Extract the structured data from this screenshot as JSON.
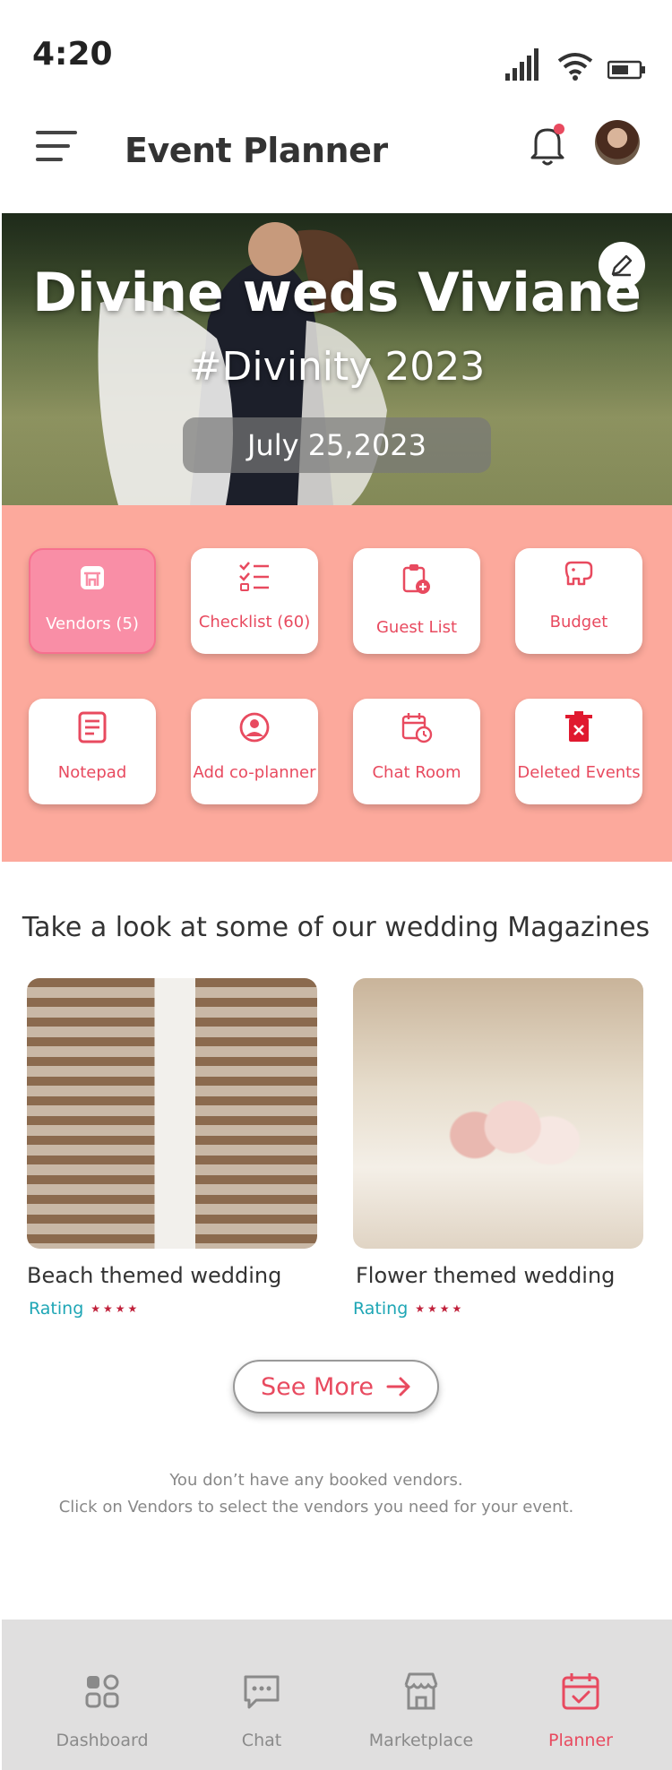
{
  "status_bar": {
    "time": "4:20"
  },
  "app_bar": {
    "title": "Event Planner"
  },
  "hero": {
    "title": "Divine weds Viviane",
    "hashtag": "#Divinity 2023",
    "date": "July 25,2023"
  },
  "actions": [
    {
      "label": "Vendors (5)",
      "icon": "store-icon",
      "active": true
    },
    {
      "label": "Checklist (60)",
      "icon": "checklist-icon"
    },
    {
      "label": "Guest List",
      "icon": "clipboard-add-icon"
    },
    {
      "label": "Budget",
      "icon": "piggy-bank-icon"
    },
    {
      "label": "Notepad",
      "icon": "notepad-icon"
    },
    {
      "label": "Add co-planner",
      "icon": "user-circle-icon"
    },
    {
      "label": "Chat Room",
      "icon": "calendar-clock-icon"
    },
    {
      "label": "Deleted Events",
      "icon": "trash-icon"
    }
  ],
  "magazines": {
    "heading": "Take a look at some of our wedding Magazines",
    "cards": [
      {
        "title": "Beach themed wedding",
        "rating_label": "Rating",
        "stars": "★★★★"
      },
      {
        "title": "Flower themed wedding",
        "rating_label": "Rating",
        "stars": "★★★★"
      }
    ],
    "see_more": "See More"
  },
  "empty_state": {
    "line1": "You don’t have any booked vendors.",
    "line2": "Click on Vendors to select the vendors you need for your event."
  },
  "bottom_nav": [
    {
      "label": "Dashboard",
      "icon": "dashboard-icon"
    },
    {
      "label": "Chat",
      "icon": "chat-icon"
    },
    {
      "label": "Marketplace",
      "icon": "store-icon"
    },
    {
      "label": "Planner",
      "icon": "calendar-check-icon",
      "active": true
    }
  ],
  "colors": {
    "accent": "#e84a5f",
    "actions_bg": "#fca99c",
    "active_tile": "#f98ea6",
    "rating": "#1ea6b5",
    "nav_bg": "#e0dfdf"
  }
}
